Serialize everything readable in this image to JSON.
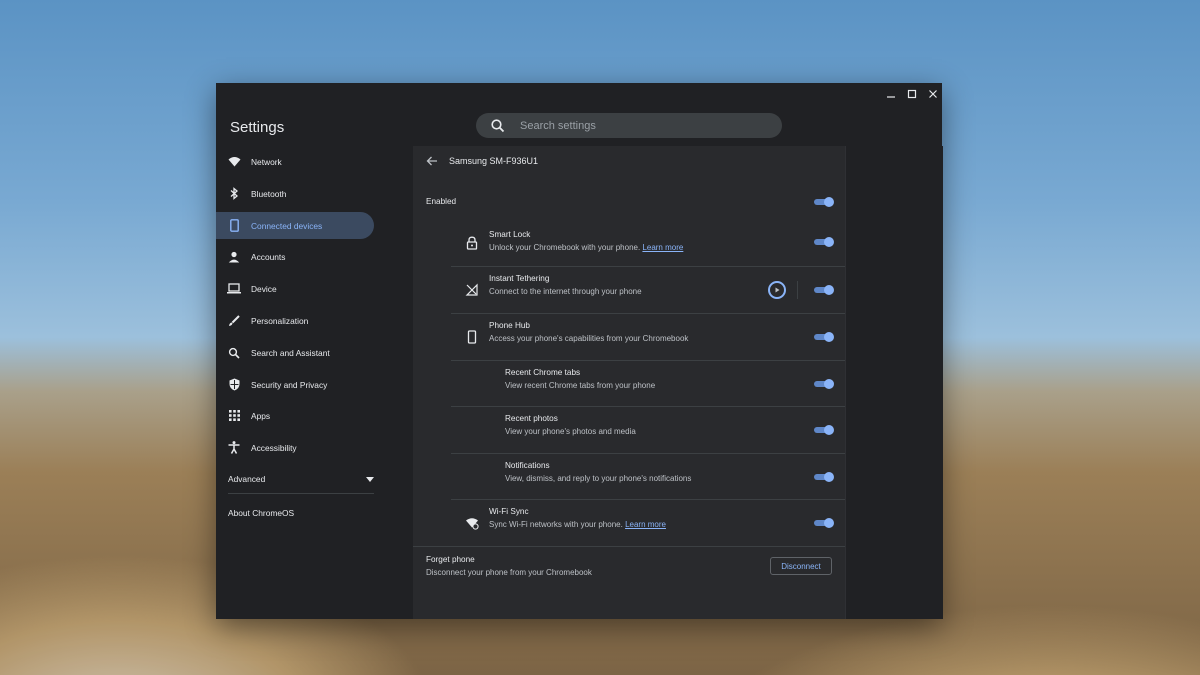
{
  "window": {
    "app_title": "Settings",
    "controls": {
      "minimize": "—",
      "maximize": "☐",
      "close": "✕"
    }
  },
  "search": {
    "placeholder": "Search settings",
    "icon": "search-icon"
  },
  "sidebar": {
    "items": [
      {
        "label": "Network",
        "icon": "wifi-icon"
      },
      {
        "label": "Bluetooth",
        "icon": "bluetooth-icon"
      },
      {
        "label": "Connected devices",
        "icon": "phone-icon",
        "active": true
      },
      {
        "label": "Accounts",
        "icon": "person-icon"
      },
      {
        "label": "Device",
        "icon": "laptop-icon"
      },
      {
        "label": "Personalization",
        "icon": "brush-icon"
      },
      {
        "label": "Search and Assistant",
        "icon": "search-icon"
      },
      {
        "label": "Security and Privacy",
        "icon": "shield-icon"
      },
      {
        "label": "Apps",
        "icon": "apps-grid-icon"
      },
      {
        "label": "Accessibility",
        "icon": "accessibility-icon"
      }
    ],
    "advanced_label": "Advanced",
    "about_label": "About ChromeOS"
  },
  "page": {
    "title": "Samsung SM-F936U1",
    "enabled_label": "Enabled",
    "features": [
      {
        "title": "Smart Lock",
        "subtitle": "Unlock your Chromebook with your phone.",
        "link": "Learn more",
        "icon": "lock-icon",
        "enabled": true
      },
      {
        "title": "Instant Tethering",
        "subtitle": "Connect to the internet through your phone",
        "icon": "tethering-signal-icon",
        "enabled": true
      },
      {
        "title": "Phone Hub",
        "subtitle": "Access your phone's capabilities from your Chromebook",
        "icon": "phone-icon",
        "enabled": true
      },
      {
        "title": "Recent Chrome tabs",
        "subtitle": "View recent Chrome tabs from your phone",
        "enabled": true
      },
      {
        "title": "Recent photos",
        "subtitle": "View your phone's photos and media",
        "enabled": true
      },
      {
        "title": "Notifications",
        "subtitle": "View, dismiss, and reply to your phone's notifications",
        "enabled": true
      },
      {
        "title": "Wi-Fi Sync",
        "subtitle": "Sync Wi-Fi networks with your phone.",
        "link": "Learn more",
        "icon": "wifi-sync-icon",
        "enabled": true
      }
    ],
    "forget": {
      "title": "Forget phone",
      "subtitle": "Disconnect your phone from your Chromebook",
      "button": "Disconnect"
    }
  },
  "colors": {
    "accent": "#8ab4f8",
    "active_bg": "#3b4a60",
    "window_bg": "#202124",
    "content_bg": "#292a2d"
  }
}
